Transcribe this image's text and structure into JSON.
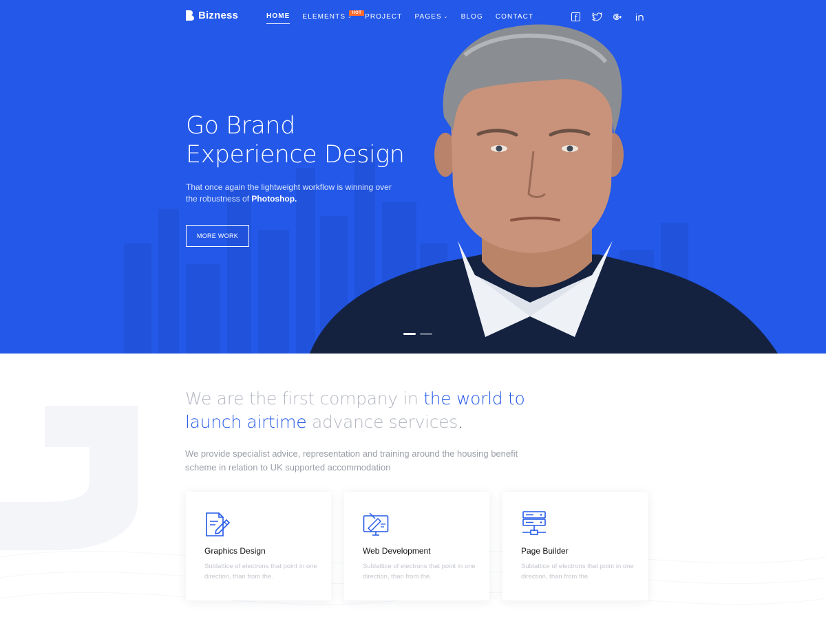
{
  "brand": {
    "name": "Bizness"
  },
  "nav": {
    "items": [
      {
        "label": "HOME",
        "active": true,
        "dropdown": false
      },
      {
        "label": "ELEMENTS",
        "active": false,
        "dropdown": true,
        "badge": "HOT"
      },
      {
        "label": "PROJECT",
        "active": false,
        "dropdown": false
      },
      {
        "label": "PAGES",
        "active": false,
        "dropdown": true
      },
      {
        "label": "BLOG",
        "active": false,
        "dropdown": false
      },
      {
        "label": "CONTACT",
        "active": false,
        "dropdown": false
      }
    ]
  },
  "socials": [
    {
      "icon": "facebook-icon"
    },
    {
      "icon": "twitter-icon"
    },
    {
      "icon": "google-plus-icon"
    },
    {
      "icon": "linkedin-icon"
    }
  ],
  "hero": {
    "title_line1": "Go Brand",
    "title_line2": "Experience Design",
    "subtitle_part1": "That once again the lightweight workflow is winning over the robustness of",
    "subtitle_bold": "Photoshop.",
    "button_label": "MORE WORK",
    "slide_count": 2,
    "active_slide": 1
  },
  "intro": {
    "headline_part1": "We are the first company in ",
    "headline_highlight": "the world to launch airtime",
    "headline_part2": " advance services",
    "headline_end": ".",
    "description": "We provide specialist advice, representation and training around the housing benefit scheme in relation to UK supported accommodation"
  },
  "services": [
    {
      "icon": "document-pen-icon",
      "title": "Graphics Design",
      "text": "Sublattice of electrons that point in one direction, than from the."
    },
    {
      "icon": "monitor-design-icon",
      "title": "Web Development",
      "text": "Sublattice of electrons that point in one direction, than from the."
    },
    {
      "icon": "server-network-icon",
      "title": "Page Builder",
      "text": "Sublattice of electrons that point in one direction, than from the."
    }
  ],
  "colors": {
    "primary": "#2358e8",
    "hot_badge": "#ff6b2c"
  }
}
